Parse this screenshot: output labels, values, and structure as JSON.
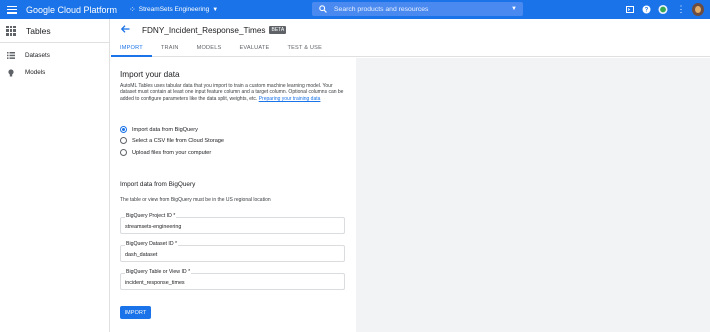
{
  "topbar": {
    "brand": "Google Cloud Platform",
    "project": "StreamSets Engineering",
    "search_placeholder": "Search products and resources",
    "avatar_badge": "4"
  },
  "leftnav": {
    "title": "Tables",
    "items": [
      {
        "label": "Datasets",
        "icon": "list-icon"
      },
      {
        "label": "Models",
        "icon": "lightbulb-icon"
      }
    ]
  },
  "header": {
    "dataset_title": "FDNY_Incident_Response_Times",
    "badge": "BETA",
    "tabs": [
      "IMPORT",
      "TRAIN",
      "MODELS",
      "EVALUATE",
      "TEST & USE"
    ],
    "active_tab": "IMPORT"
  },
  "import": {
    "heading": "Import your data",
    "description": "AutoML Tables uses tabular data that you import to train a custom machine learning model. Your dataset must contain at least one input feature column and a target column. Optional columns can be added to configure parameters like the data split, weights, etc.",
    "description_link": "Preparing your training data",
    "options": [
      {
        "label": "Import data from BigQuery",
        "selected": true
      },
      {
        "label": "Select a CSV file from Cloud Storage",
        "selected": false
      },
      {
        "label": "Upload files from your computer",
        "selected": false
      }
    ],
    "bq_heading": "Import data from BigQuery",
    "bq_note": "The table or view from BigQuery must be in the US regional location",
    "fields": [
      {
        "label": "BigQuery Project ID *",
        "value": "streamsets-engineering"
      },
      {
        "label": "BigQuery Dataset ID *",
        "value": "dash_dataset"
      },
      {
        "label": "BigQuery Table or View ID *",
        "value": "incident_response_times"
      }
    ],
    "button": "IMPORT"
  },
  "colors": {
    "accent": "#1a73e8",
    "background": "#f1f3f4"
  }
}
